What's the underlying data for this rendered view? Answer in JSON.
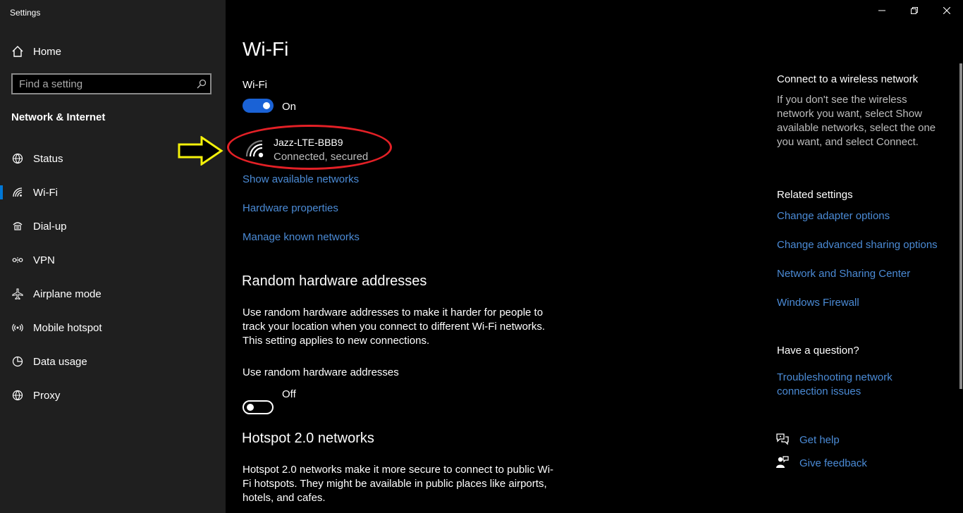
{
  "app": {
    "title": "Settings"
  },
  "window_controls": {
    "minimize_icon": "minimize-icon",
    "restore_icon": "restore-icon",
    "close_icon": "close-icon"
  },
  "sidebar": {
    "home_label": "Home",
    "search": {
      "placeholder": "Find a setting",
      "value": ""
    },
    "section_title": "Network & Internet",
    "items": [
      {
        "label": "Status",
        "icon": "globe-status-icon",
        "active": false
      },
      {
        "label": "Wi-Fi",
        "icon": "wifi-icon",
        "active": true
      },
      {
        "label": "Dial-up",
        "icon": "dialup-icon",
        "active": false
      },
      {
        "label": "VPN",
        "icon": "vpn-icon",
        "active": false
      },
      {
        "label": "Airplane mode",
        "icon": "airplane-icon",
        "active": false
      },
      {
        "label": "Mobile hotspot",
        "icon": "hotspot-icon",
        "active": false
      },
      {
        "label": "Data usage",
        "icon": "data-usage-icon",
        "active": false
      },
      {
        "label": "Proxy",
        "icon": "globe-icon",
        "active": false
      }
    ]
  },
  "main": {
    "title": "Wi-Fi",
    "wifi_toggle": {
      "label": "Wi-Fi",
      "state": "On"
    },
    "network": {
      "name": "Jazz-LTE-BBB9",
      "status": "Connected, secured"
    },
    "links": {
      "show_available": "Show available networks",
      "hardware_properties": "Hardware properties",
      "manage_known": "Manage known networks"
    },
    "random_hw": {
      "heading": "Random hardware addresses",
      "description_lines": [
        "Use random hardware addresses to make it harder for people to",
        "track your location when you connect to different Wi-Fi networks.",
        "This setting applies to new connections."
      ],
      "toggle_label": "Use random hardware addresses",
      "state": "Off"
    },
    "hotspot20": {
      "heading": "Hotspot 2.0 networks",
      "description_lines": [
        "Hotspot 2.0 networks make it more secure to connect to public Wi-",
        "Fi hotspots. They might be available in public places like airports,",
        "hotels, and cafes."
      ]
    }
  },
  "right_panel": {
    "connect_heading": "Connect to a wireless network",
    "connect_lines": [
      "If you don't see the wireless",
      "network you want, select Show",
      "available networks, select the one",
      "you want, and select Connect."
    ],
    "related_heading": "Related settings",
    "related_links": [
      "Change adapter options",
      "Change advanced sharing options",
      "Network and Sharing Center",
      "Windows Firewall"
    ],
    "question_heading": "Have a question?",
    "troubleshoot_lines": [
      "Troubleshooting network",
      "connection issues"
    ],
    "get_help": "Get help",
    "give_feedback": "Give feedback"
  },
  "annotations": {
    "ellipse_color": "#e32026",
    "arrow_color": "#f4f10a"
  },
  "colors": {
    "accent": "#1a62d6",
    "link": "#4b8bd6",
    "sidebar_bg": "#1f1f1f"
  }
}
